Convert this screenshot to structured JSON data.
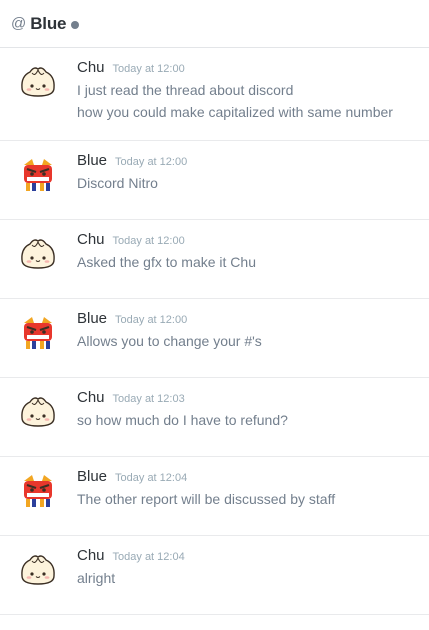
{
  "header": {
    "at_symbol": "@",
    "title": "Blue"
  },
  "messages": [
    {
      "author": "Chu",
      "avatar": "dumpling",
      "timestamp": "Today at 12:00",
      "lines": [
        "I just read the thread about discord",
        "how you could make capitalized with same number"
      ]
    },
    {
      "author": "Blue",
      "avatar": "red-bird",
      "timestamp": "Today at 12:00",
      "lines": [
        "Discord Nitro"
      ]
    },
    {
      "author": "Chu",
      "avatar": "dumpling",
      "timestamp": "Today at 12:00",
      "lines": [
        "Asked the gfx to make it Chu"
      ]
    },
    {
      "author": "Blue",
      "avatar": "red-bird",
      "timestamp": "Today at 12:00",
      "lines": [
        "Allows you to change your #'s"
      ]
    },
    {
      "author": "Chu",
      "avatar": "dumpling",
      "timestamp": "Today at 12:03",
      "lines": [
        "so how much do I have to refund?"
      ]
    },
    {
      "author": "Blue",
      "avatar": "red-bird",
      "timestamp": "Today at 12:04",
      "lines": [
        "The other report will be discussed by staff"
      ]
    },
    {
      "author": "Chu",
      "avatar": "dumpling",
      "timestamp": "Today at 12:04",
      "lines": [
        "alright"
      ]
    }
  ],
  "colors": {
    "status_offline": "#747f8d",
    "username": "#2e3338",
    "message_text": "#737f8d",
    "timestamp": "#99aab5"
  }
}
